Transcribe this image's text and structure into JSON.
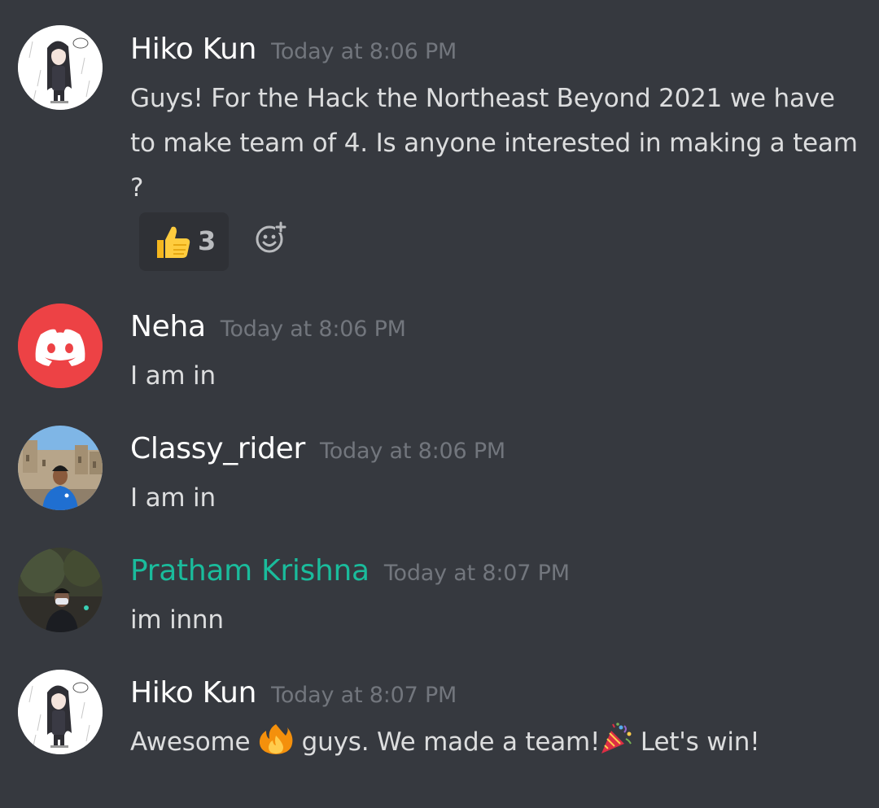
{
  "messages": [
    {
      "username": "Hiko Kun",
      "timestamp": "Today at 8:06 PM",
      "text": "Guys! For the Hack the Northeast Beyond 2021 we have to make team of 4. Is anyone interested in making a team ?",
      "name_color": "#ffffff",
      "avatar": "anime-girl-avatar",
      "reactions": [
        {
          "emoji": "thumbs-up-icon",
          "count": "3"
        }
      ]
    },
    {
      "username": "Neha",
      "timestamp": "Today at 8:06 PM",
      "text": "I am in",
      "name_color": "#ffffff",
      "avatar": "discord-logo-avatar"
    },
    {
      "username": "Classy_rider",
      "timestamp": "Today at 8:06 PM",
      "text": "I am in",
      "name_color": "#ffffff",
      "avatar": "photo-avatar"
    },
    {
      "username": "Pratham Krishna",
      "timestamp": "Today at 8:07 PM",
      "text": "im innn",
      "name_color": "#1abc9c",
      "avatar": "photo-avatar"
    },
    {
      "username": "Hiko Kun",
      "timestamp": "Today at 8:07 PM",
      "text_parts": [
        "Awesome ",
        " guys. We made a team!",
        " Let's win!"
      ],
      "name_color": "#ffffff",
      "avatar": "anime-girl-avatar",
      "inline_emojis": [
        "fire-icon",
        "party-popper-icon"
      ]
    }
  ],
  "colors": {
    "background": "#36393f",
    "timestamp": "#72767d",
    "message_text": "#dcddde",
    "reaction_bg": "#2f3136"
  }
}
